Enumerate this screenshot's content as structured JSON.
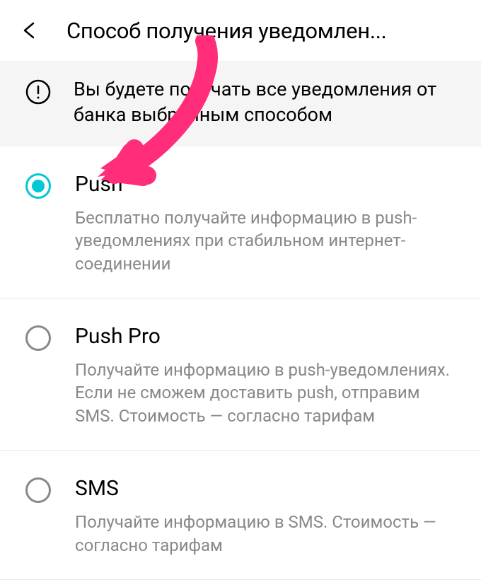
{
  "header": {
    "title": "Способ получения уведомлен..."
  },
  "info": {
    "text": "Вы будете получать все уведомления от банка выбранным способом"
  },
  "options": [
    {
      "title": "Push",
      "description": "Бесплатно получайте информацию в push-уведомлениях при стабильном интернет-соединении",
      "selected": true
    },
    {
      "title": "Push Pro",
      "description": "Получайте информацию в push-уведомлениях. Если не сможем доставить push, отправим SMS. Стоимость — согласно тарифам",
      "selected": false
    },
    {
      "title": "SMS",
      "description": "Получайте информацию в SMS. Стоимость — согласно тарифам",
      "selected": false
    }
  ]
}
